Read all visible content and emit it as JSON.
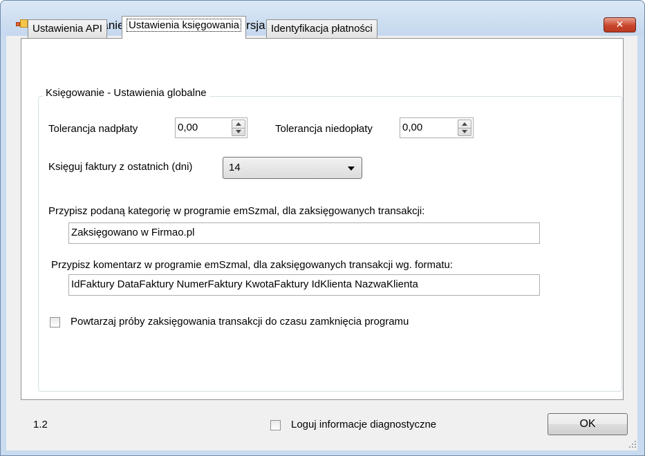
{
  "window": {
    "title": "Autoksięgowanie faktur w Firmao.pl - wersja 1.2",
    "close_label": "✕"
  },
  "tabs": [
    {
      "label": "Ustawienia API",
      "active": false
    },
    {
      "label": "Ustawienia księgowania",
      "active": true
    },
    {
      "label": "Identyfikacja płatności",
      "active": false
    }
  ],
  "group": {
    "title": "Księgowanie - Ustawienia globalne"
  },
  "overpay": {
    "label": "Tolerancja nadpłaty",
    "value": "0,00"
  },
  "underpay": {
    "label": "Tolerancja niedopłaty",
    "value": "0,00"
  },
  "days": {
    "label": "Księguj faktury z ostatnich (dni)",
    "value": "14"
  },
  "category": {
    "label": "Przypisz podaną kategorię w programie emSzmal, dla zaksięgowanych transakcji:",
    "value": "Zaksięgowano w Firmao.pl"
  },
  "comment": {
    "label": "Przypisz komentarz w programie emSzmal, dla zaksięgowanych transakcji wg. formatu:",
    "value": "IdFaktury DataFaktury NumerFaktury KwotaFaktury IdKlienta NazwaKlienta"
  },
  "retry": {
    "label": "Powtarzaj próby zaksięgowania transakcji do czasu zamknięcia programu",
    "checked": false
  },
  "footer": {
    "version": "1.2",
    "diagnostics_label": "Loguj informacje diagnostyczne",
    "diagnostics_checked": false,
    "ok_label": "OK"
  },
  "colors": {
    "titlebar": "#c9dbef",
    "close": "#c9462c",
    "client": "#f0f0f0"
  }
}
